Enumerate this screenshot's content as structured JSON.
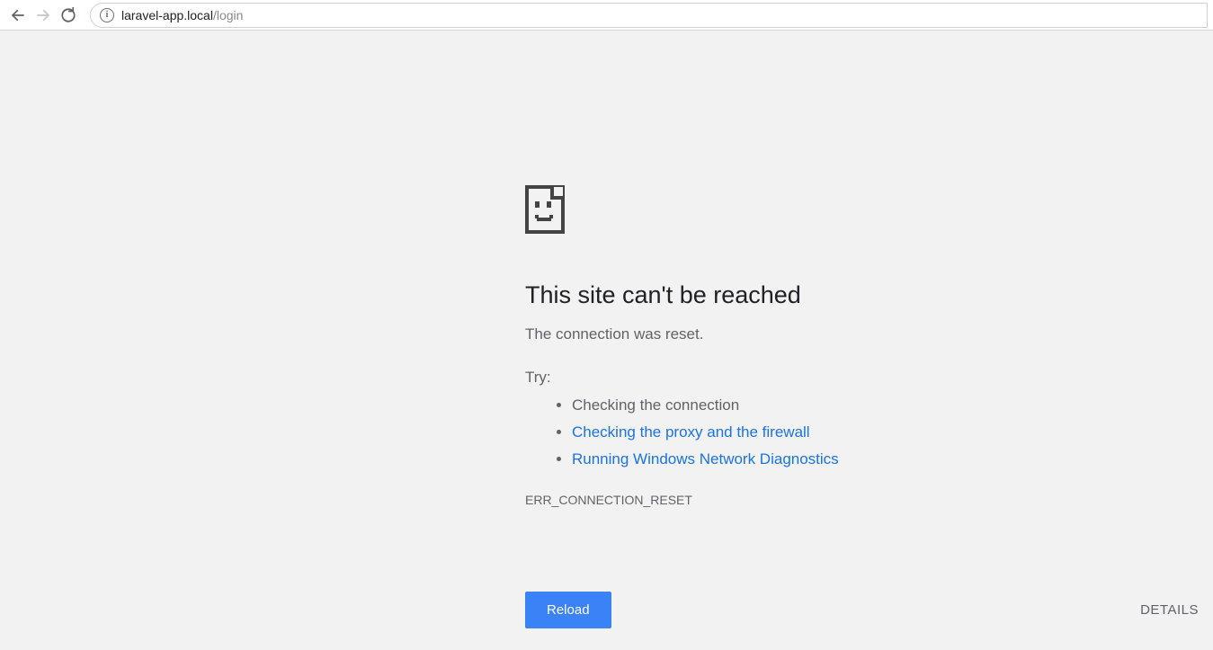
{
  "address": {
    "host": "laravel-app.local",
    "path": "/login"
  },
  "error": {
    "title": "This site can't be reached",
    "message": "The connection was reset.",
    "try_label": "Try:",
    "suggestions": {
      "check_conn": "Checking the connection",
      "check_proxy": "Checking the proxy and the firewall",
      "run_diag": "Running Windows Network Diagnostics"
    },
    "code": "ERR_CONNECTION_RESET",
    "reload_label": "Reload",
    "details_label": "DETAILS"
  }
}
